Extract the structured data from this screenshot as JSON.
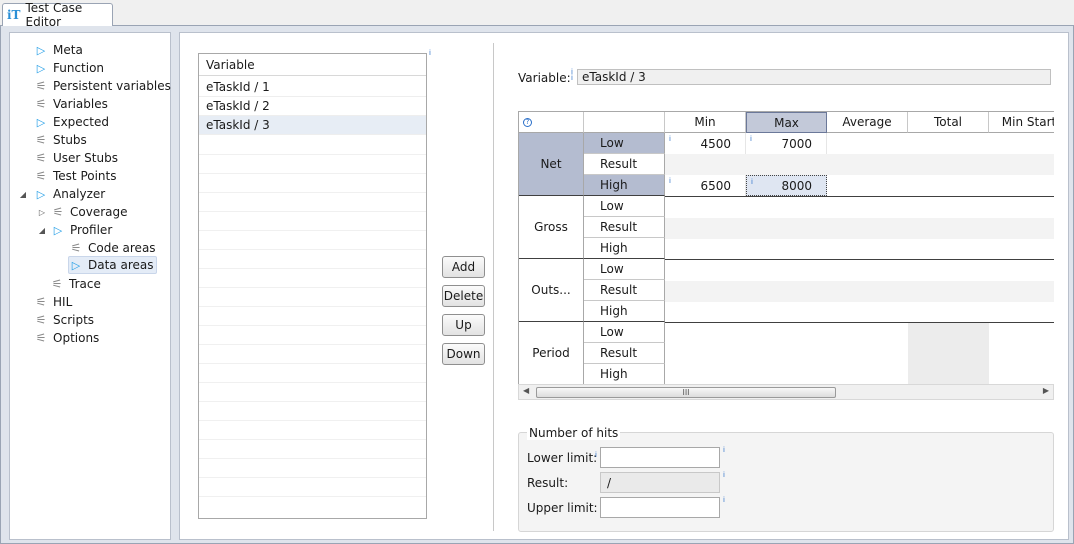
{
  "window": {
    "tab_title": "Test Case Editor",
    "tab_icon": "iT"
  },
  "sidebar": {
    "items": [
      {
        "label": "Meta",
        "icon": "play-icon"
      },
      {
        "label": "Function",
        "icon": "play-icon"
      },
      {
        "label": "Persistent variables",
        "icon": "wand-icon"
      },
      {
        "label": "Variables",
        "icon": "wand-icon"
      },
      {
        "label": "Expected",
        "icon": "play-icon"
      },
      {
        "label": "Stubs",
        "icon": "wand-icon"
      },
      {
        "label": "User Stubs",
        "icon": "wand-icon"
      },
      {
        "label": "Test Points",
        "icon": "wand-icon"
      },
      {
        "label": "Analyzer",
        "icon": "play-icon"
      },
      {
        "label": "Coverage",
        "icon": "wand-icon"
      },
      {
        "label": "Profiler",
        "icon": "play-icon"
      },
      {
        "label": "Code areas",
        "icon": "wand-icon"
      },
      {
        "label": "Data areas",
        "icon": "play-icon"
      },
      {
        "label": "Trace",
        "icon": "wand-icon"
      },
      {
        "label": "HIL",
        "icon": "wand-icon"
      },
      {
        "label": "Scripts",
        "icon": "wand-icon"
      },
      {
        "label": "Options",
        "icon": "wand-icon"
      }
    ]
  },
  "variable_list": {
    "header": "Variable",
    "rows": [
      "eTaskId / 1",
      "eTaskId / 2",
      "eTaskId / 3"
    ],
    "selected_index": 2
  },
  "buttons": {
    "add": "Add",
    "delete": "Delete",
    "up": "Up",
    "down": "Down"
  },
  "variable_field": {
    "label": "Variable:",
    "value": "eTaskId / 3"
  },
  "stats_grid": {
    "help_icon": "?",
    "columns": [
      "Min",
      "Max",
      "Average",
      "Total",
      "Min Start"
    ],
    "groups": [
      {
        "name": "Net",
        "rows": [
          "Low",
          "Result",
          "High"
        ]
      },
      {
        "name": "Gross",
        "rows": [
          "Low",
          "Result",
          "High"
        ]
      },
      {
        "name": "Outs...",
        "rows": [
          "Low",
          "Result",
          "High"
        ]
      },
      {
        "name": "Period",
        "rows": [
          "Low",
          "Result",
          "High"
        ]
      }
    ],
    "values": {
      "net_low_min": "4500",
      "net_low_max": "7000",
      "net_high_min": "6500",
      "net_high_max": "8000"
    },
    "scroll_grip": "III"
  },
  "number_of_hits": {
    "title": "Number of hits",
    "lower_label": "Lower limit:",
    "lower_value": "",
    "result_label": "Result:",
    "result_value": "/",
    "upper_label": "Upper limit:",
    "upper_value": ""
  },
  "info_marker": "i"
}
